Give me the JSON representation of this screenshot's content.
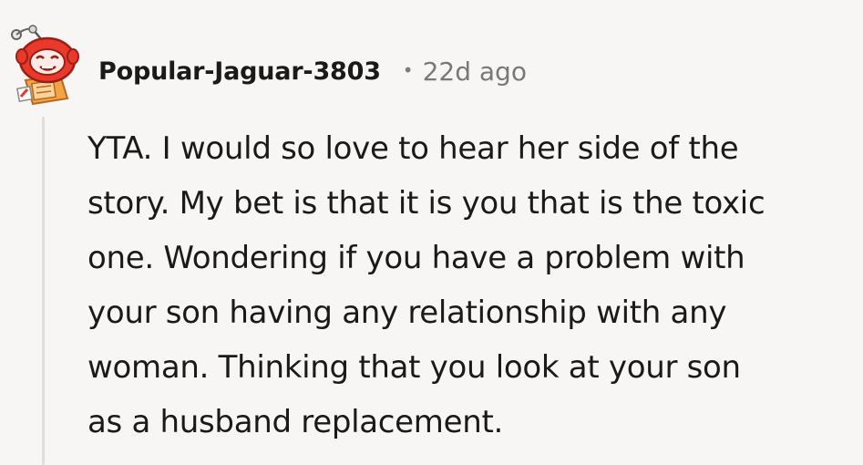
{
  "comment": {
    "author": "Popular-Jaguar-3803",
    "separator": "•",
    "timestamp": "22d ago",
    "avatar_icon": "snoo-avatar-icon",
    "body_lines": [
      "YTA. I would so love to hear her side of the",
      "story. My bet is that it is you that is the toxic",
      "one. Wondering if you have a problem with",
      "your son having any relationship with any",
      "woman. Thinking that you look at your son",
      "as a husband replacement."
    ]
  },
  "colors": {
    "background": "#f8f6f4",
    "text": "#1a1a1b",
    "meta_text": "#787878",
    "thread_line": "#e2ddd8",
    "avatar_red": "#e8392b",
    "avatar_orange": "#f3a447"
  }
}
